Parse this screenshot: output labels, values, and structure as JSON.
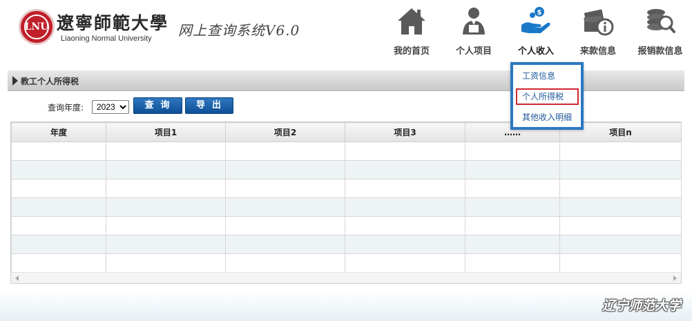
{
  "brand": {
    "seal_text": "LNU",
    "cn_name": "遼寧師範大學",
    "en_name": "Liaoning Normal University",
    "system_title": "网上查询系统V6.0"
  },
  "nav": [
    {
      "label": "我的首页",
      "icon": "home-icon"
    },
    {
      "label": "个人项目",
      "icon": "person-icon"
    },
    {
      "label": "个人收入",
      "icon": "money-hand-icon",
      "active": true
    },
    {
      "label": "来款信息",
      "icon": "money-info-icon"
    },
    {
      "label": "报销款信息",
      "icon": "coins-search-icon"
    }
  ],
  "section": {
    "title": "教工个人所得税"
  },
  "query": {
    "year_label": "查询年度:",
    "year_value": "2023",
    "search_button": "查询",
    "export_button": "导出"
  },
  "table": {
    "headers": [
      "年度",
      "项目1",
      "项目2",
      "项目3",
      "……",
      "项目n"
    ],
    "row_count": 7
  },
  "dropdown": {
    "items": [
      "工资信息",
      "个人所得税",
      "其他收入明细"
    ],
    "selected_index": 1
  },
  "footer": {
    "signature": "辽宁师范大学"
  },
  "colors": {
    "accent": "#2a78c3",
    "button": "#1a5fa8",
    "selected_border": "#d0262f",
    "alt_row": "#eef3f6"
  }
}
